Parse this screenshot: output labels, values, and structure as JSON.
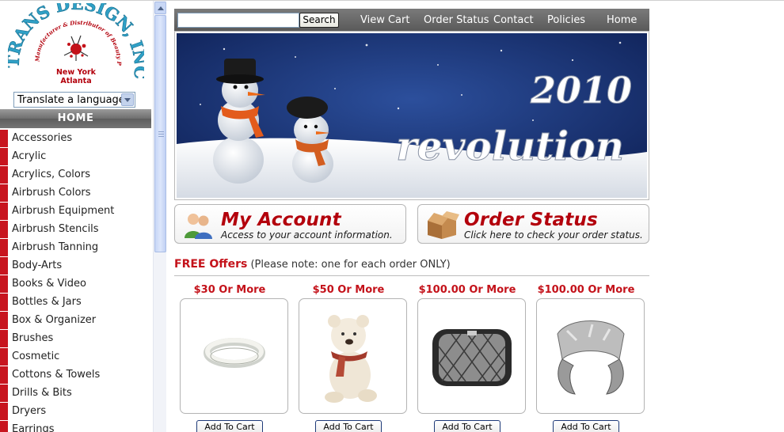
{
  "logo": {
    "brand": "TRANS DESIGN, INC.",
    "tagline": "Manufacturer & Distributor of Beauty Products",
    "cities": [
      "New York",
      "Atlanta"
    ]
  },
  "translate": {
    "selected": "Translate a language"
  },
  "sidebar": {
    "home_label": "HOME",
    "categories": [
      "Accessories",
      "Acrylic",
      "Acrylics, Colors",
      "Airbrush Colors",
      "Airbrush Equipment",
      "Airbrush Stencils",
      "Airbrush Tanning",
      "Body-Arts",
      "Books & Video",
      "Bottles & Jars",
      "Box & Organizer",
      "Brushes",
      "Cosmetic",
      "Cottons & Towels",
      "Drills & Bits",
      "Dryers",
      "Earrings"
    ]
  },
  "nav": {
    "search_placeholder": "",
    "search_button": "Search",
    "links": [
      "View Cart",
      "Order Status",
      "Contact",
      "Policies",
      "Home"
    ]
  },
  "banner": {
    "year": "2010",
    "word": "revolution"
  },
  "account_box": {
    "title": "My Account",
    "subtitle": "Access to your account information."
  },
  "order_box": {
    "title": "Order Status",
    "subtitle": "Click here to check your order status."
  },
  "offers": {
    "heading": "FREE Offers",
    "note": "(Please note: one for each order ONLY)",
    "items": [
      {
        "price": "$30 Or More",
        "button": "Add To Cart",
        "product": "bracelet"
      },
      {
        "price": "$50 Or More",
        "button": "Add To Cart",
        "product": "teddy-bear"
      },
      {
        "price": "$100.00 Or More",
        "button": "Add To Cart",
        "product": "quilted-pouch"
      },
      {
        "price": "$100.00 Or More",
        "button": "Add To Cart",
        "product": "cuff"
      }
    ]
  },
  "colors": {
    "accent_red": "#c4121a",
    "nav_gray": "#6a6a6a",
    "category_marker": "#c8151f"
  }
}
